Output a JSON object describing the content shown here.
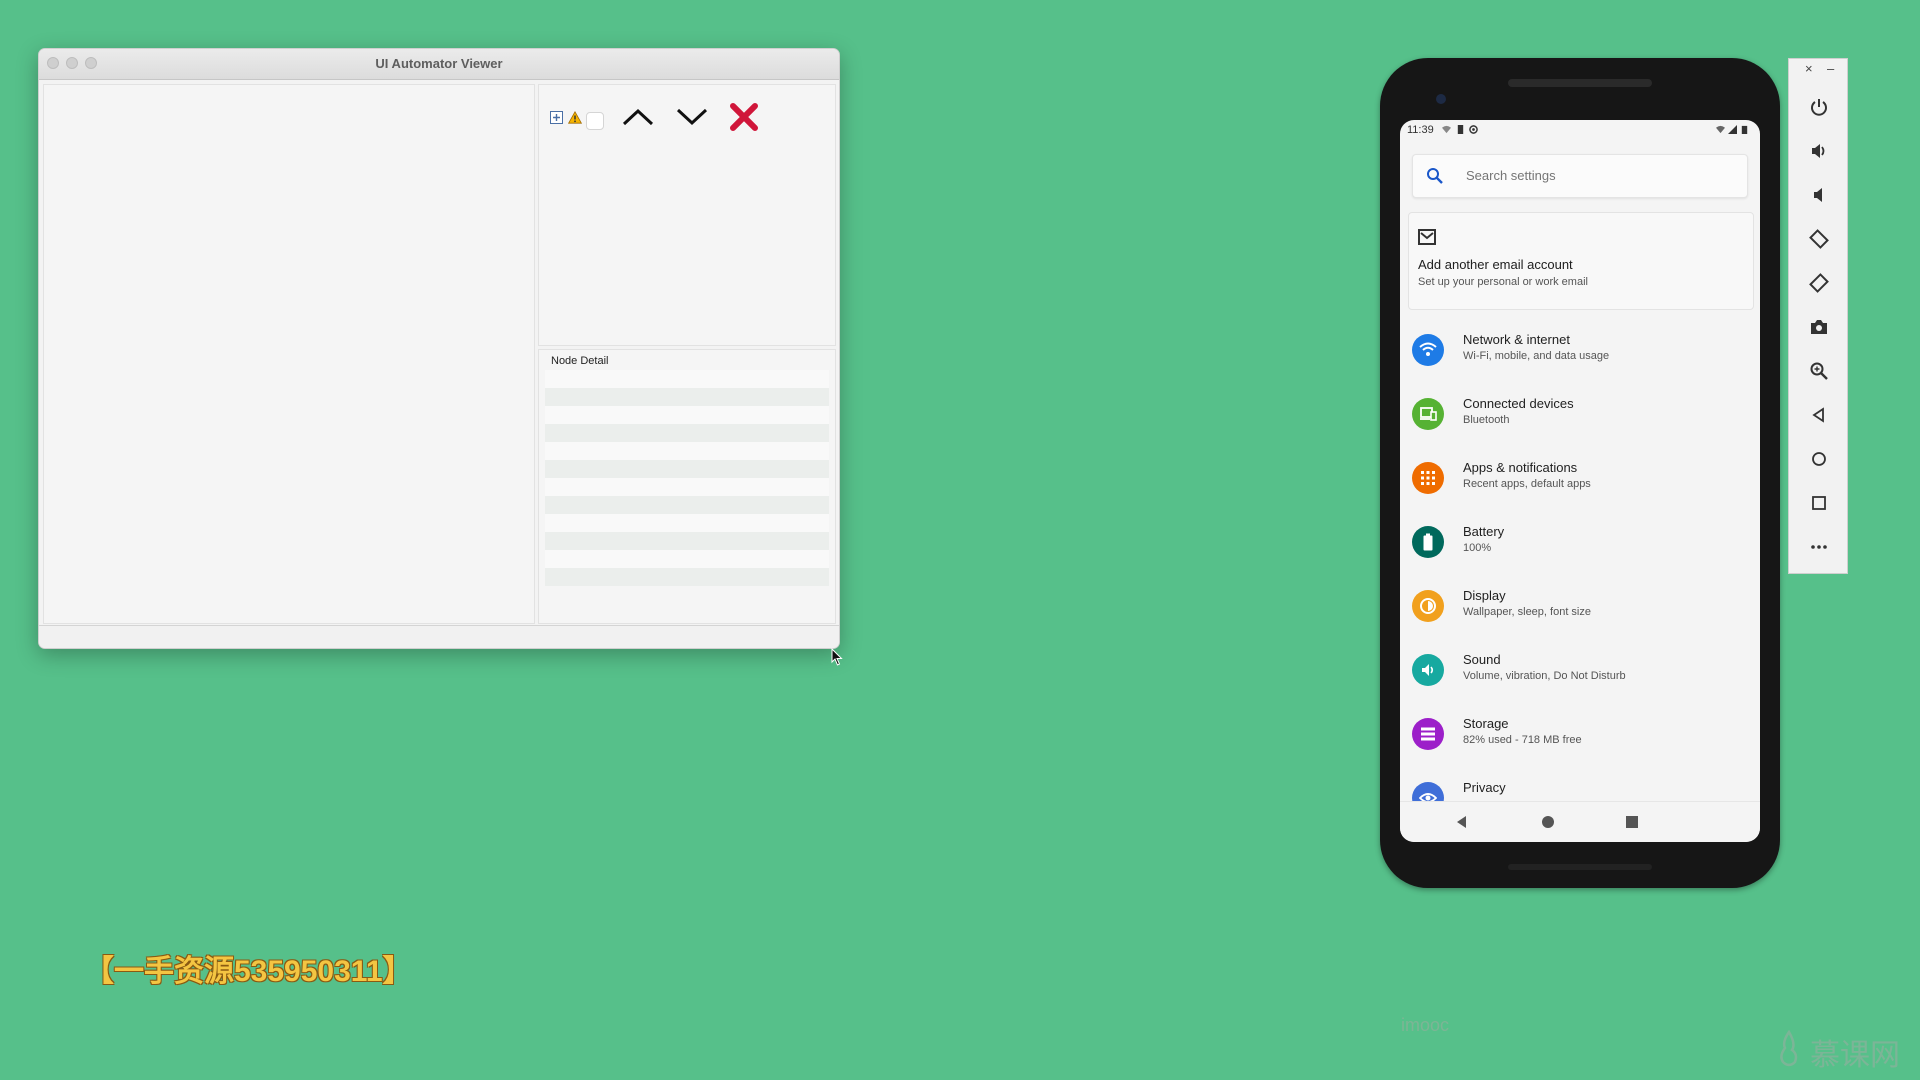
{
  "viewer": {
    "title": "UI Automator Viewer",
    "detail_title": "Node Detail",
    "toolbar": {
      "expand_icon": "expand-all-icon",
      "warning_icon": "warning-icon",
      "up_icon": "chevron-up-icon",
      "down_icon": "chevron-down-icon",
      "close_icon": "close-icon",
      "close_color": "#d0163a"
    },
    "detail_rows": 12
  },
  "phone": {
    "status": {
      "time": "11:39"
    },
    "search": {
      "placeholder": "Search settings"
    },
    "card": {
      "title": "Add another email account",
      "subtitle": "Set up your personal or work email"
    },
    "items": [
      {
        "title": "Network & internet",
        "subtitle": "Wi-Fi, mobile, and data usage",
        "icon": "wifi-icon",
        "color": "#1e7be6"
      },
      {
        "title": "Connected devices",
        "subtitle": "Bluetooth",
        "icon": "devices-icon",
        "color": "#56b233"
      },
      {
        "title": "Apps & notifications",
        "subtitle": "Recent apps, default apps",
        "icon": "apps-icon",
        "color": "#ef6c00"
      },
      {
        "title": "Battery",
        "subtitle": "100%",
        "icon": "battery-icon",
        "color": "#00695c"
      },
      {
        "title": "Display",
        "subtitle": "Wallpaper, sleep, font size",
        "icon": "display-icon",
        "color": "#f1a01d"
      },
      {
        "title": "Sound",
        "subtitle": "Volume, vibration, Do Not Disturb",
        "icon": "sound-icon",
        "color": "#17a9a0"
      },
      {
        "title": "Storage",
        "subtitle": "82% used - 718 MB free",
        "icon": "storage-icon",
        "color": "#9c1fc9"
      },
      {
        "title": "Privacy",
        "subtitle": "",
        "icon": "privacy-icon",
        "color": "#3f6ed8"
      }
    ]
  },
  "emulator_toolbar": {
    "close": "×",
    "minimize": "–",
    "buttons": [
      "power-icon",
      "volume-up-icon",
      "volume-down-icon",
      "rotate-left-icon",
      "rotate-right-icon",
      "camera-icon",
      "zoom-icon",
      "back-icon",
      "home-icon",
      "overview-icon",
      "more-icon"
    ]
  },
  "overlay": {
    "watermark": "【一手资源535950311】",
    "imooc": "imooc",
    "logo": "慕课网"
  }
}
